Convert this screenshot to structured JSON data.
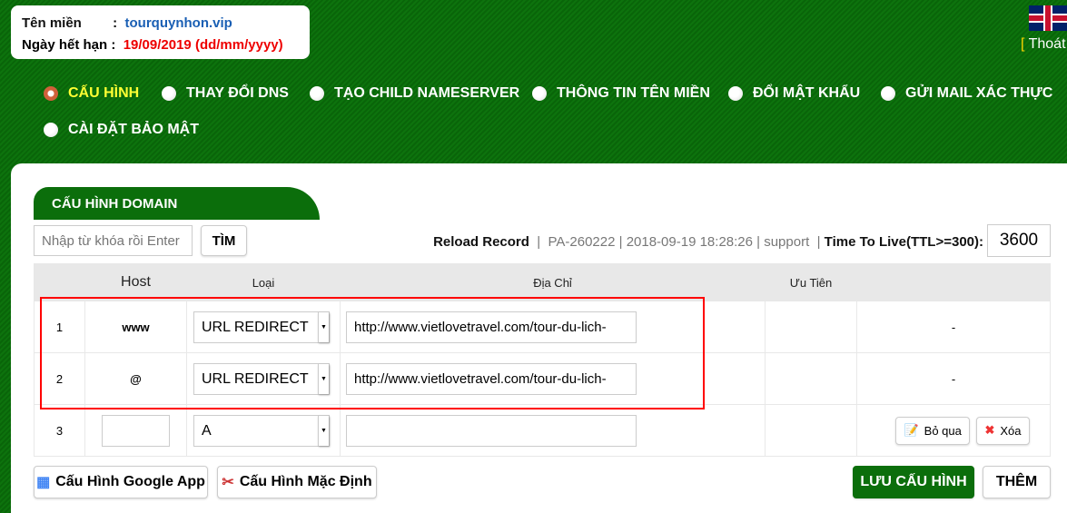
{
  "domain_info": {
    "name_label": "Tên miền",
    "sep": ":",
    "name": "tourquynhon.vip",
    "expiry_label": "Ngày hết hạn",
    "expiry": "19/09/2019 (dd/mm/yyyy)"
  },
  "language_icon": "uk-flag-icon",
  "logout": {
    "bracket": "[",
    "label": "Thoát"
  },
  "nav": [
    {
      "label": "CẤU HÌNH",
      "active": true
    },
    {
      "label": "THAY ĐỔI DNS"
    },
    {
      "label": "TẠO CHILD NAMESERVER"
    },
    {
      "label": "THÔNG TIN TÊN MIỀN"
    },
    {
      "label": "ĐỔI MẬT KHẨU"
    },
    {
      "label": "GỬI MAIL XÁC THỰC"
    },
    {
      "label": "CÀI ĐẶT BẢO MẬT"
    }
  ],
  "tab_title": "CẤU HÌNH DOMAIN",
  "search": {
    "placeholder": "Nhập từ khóa rồi Enter",
    "button": "TÌM"
  },
  "meta": {
    "reload": "Reload Record",
    "sep": "|",
    "info": "PA-260222 | 2018-09-19 18:28:26 | support",
    "ttl_label": "Time To Live(TTL>=300):",
    "ttl_value": "3600"
  },
  "table": {
    "headers": [
      "",
      "Host",
      "Loại",
      "Địa Chỉ",
      "Ưu Tiên",
      ""
    ],
    "rows": [
      {
        "num": "1",
        "host": "www",
        "type": "URL REDIRECT",
        "address": "http://www.vietlovetravel.com/tour-du-lich-",
        "action": "-"
      },
      {
        "num": "2",
        "host": "@",
        "type": "URL REDIRECT",
        "address": "http://www.vietlovetravel.com/tour-du-lich-",
        "action": "-"
      },
      {
        "num": "3",
        "host": "",
        "type": "A",
        "address": "",
        "skip": "Bỏ qua",
        "delete": "Xóa"
      }
    ]
  },
  "buttons": {
    "google": "Cấu Hình Google App",
    "default": "Cấu Hình Mặc Định",
    "save": "LƯU CẤU HÌNH",
    "add": "THÊM"
  },
  "colors": {
    "brand_green": "#0b6e0b",
    "active_nav": "#ffff33",
    "highlight": "#ff0000"
  }
}
